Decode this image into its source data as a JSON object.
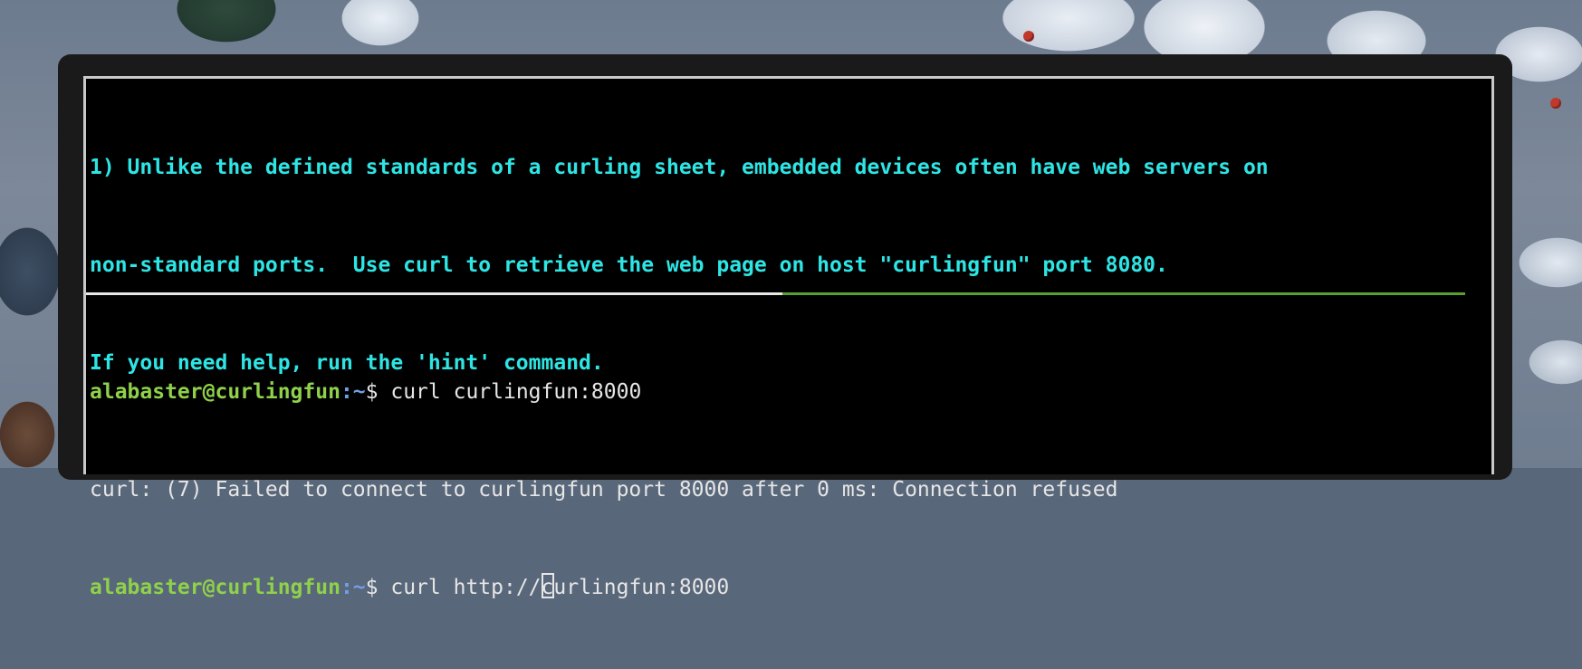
{
  "objective": {
    "lines": [
      "1) Unlike the defined standards of a curling sheet, embedded devices often have web servers on",
      "non-standard ports.  Use curl to retrieve the web page on host \"curlingfun\" port 8080.",
      "If you need help, run the 'hint' command."
    ]
  },
  "terminal": {
    "prompt_user": "alabaster@curlingfun",
    "prompt_path": ":~",
    "prompt_symbol": "$ ",
    "history": [
      {
        "type": "command",
        "text": "curl curlingfun:8000"
      },
      {
        "type": "output",
        "text": "curl: (7) Failed to connect to curlingfun port 8000 after 0 ms: Connection refused"
      }
    ],
    "current_input_before_cursor": "curl http://",
    "current_input_after_cursor": "curlingfun:8000"
  },
  "colors": {
    "objective_text": "#2ee5e5",
    "prompt_user": "#8fd14a",
    "terminal_bg": "#000000",
    "divider_left": "#e8e8e8",
    "divider_right": "#5aa02c"
  }
}
